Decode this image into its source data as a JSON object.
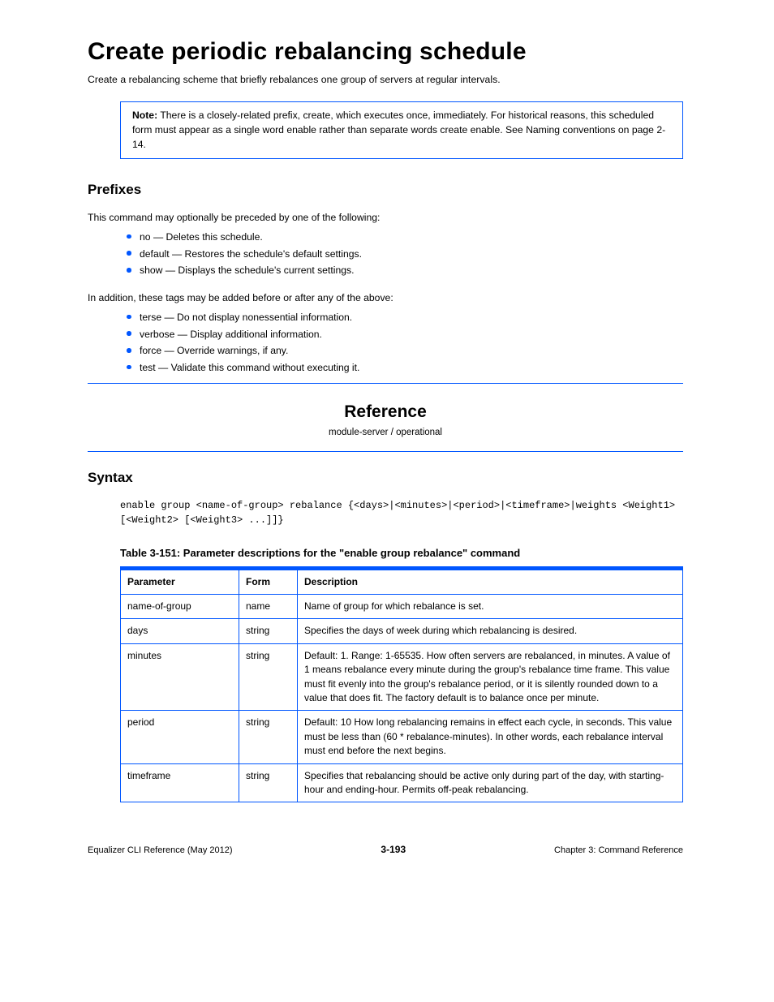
{
  "title": "Create periodic rebalancing schedule",
  "subtitle": "Create a rebalancing scheme that briefly rebalances one group of servers at regular intervals.",
  "note": {
    "label": "Note:",
    "text": "There is a closely-related prefix, create, which executes once, immediately. For historical reasons, this scheduled form must appear as a single word enable rather than separate words create enable. See Naming conventions on page 2-14."
  },
  "prefixes_heading": "Prefixes",
  "prefixes_text": "This command may optionally be preceded by one of the following:",
  "prefixes_list": [
    "no — Deletes this schedule.",
    "default — Restores the schedule's default settings.",
    "show — Displays the schedule's current settings."
  ],
  "tags_text": "In addition, these tags may be added before or after any of the above:",
  "tags_list": [
    "terse — Do not display nonessential information.",
    "verbose — Display additional information.",
    "force — Override warnings, if any.",
    "test — Validate this command without executing it."
  ],
  "reference_heading": "Reference",
  "reference_sub": "module-server / operational",
  "syntax_heading": "Syntax",
  "syntax_code": "enable group <name-of-group> rebalance {<days>|<minutes>|<period>|<timeframe>|weights <Weight1> [<Weight2> [<Weight3> ...]]}",
  "table_caption": "Table 3-151: Parameter descriptions for the \"enable group rebalance\" command",
  "table": {
    "headers": [
      "Parameter",
      "Form",
      "Description"
    ],
    "rows": [
      {
        "param": "name-of-group",
        "form": "name",
        "desc": "Name of group for which rebalance is set."
      },
      {
        "param": "days",
        "form": "string",
        "desc": "Specifies the days of week during which rebalancing is desired."
      },
      {
        "param": "minutes",
        "form": "string",
        "desc": "Default: 1. Range: 1-65535.\nHow often servers are rebalanced, in minutes. A value of 1 means rebalance every minute during the group's rebalance time frame. This value must fit evenly into the group's rebalance period, or it is silently rounded down to a value that does fit. The factory default is to balance once per minute."
      },
      {
        "param": "period",
        "form": "string",
        "desc": "Default: 10\nHow long rebalancing remains in effect each cycle, in seconds. This value must be less than (60 * rebalance-minutes). In other words, each rebalance interval must end before the next begins."
      },
      {
        "param": "timeframe",
        "form": "string",
        "desc": "Specifies that rebalancing should be active only during part of the day, with starting-hour and ending-hour. Permits off-peak rebalancing."
      }
    ]
  },
  "footer": {
    "left": "Equalizer CLI Reference (May 2012)",
    "center": "3-193",
    "right": "Chapter 3: Command Reference"
  }
}
